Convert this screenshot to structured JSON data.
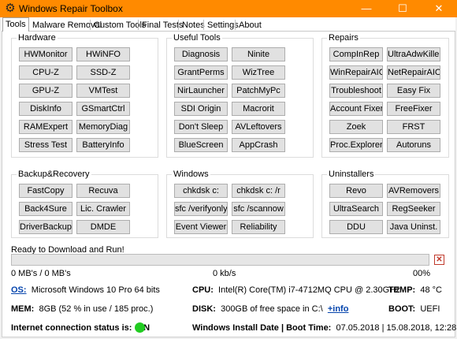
{
  "window": {
    "title": "Windows Repair Toolbox",
    "minimize": "—",
    "maximize": "☐",
    "close": "✕"
  },
  "tabs": [
    "Tools",
    "Malware Removal",
    "Custom Tools",
    "Final Tests",
    "Notes",
    "Settings",
    "About"
  ],
  "groups": {
    "hardware": {
      "label": "Hardware",
      "buttons": [
        "HWMonitor",
        "HWiNFO",
        "CPU-Z",
        "SSD-Z",
        "GPU-Z",
        "VMTest",
        "DiskInfo",
        "GSmartCtrl",
        "RAMExpert",
        "MemoryDiag",
        "Stress Test",
        "BatteryInfo"
      ]
    },
    "useful": {
      "label": "Useful Tools",
      "buttons": [
        "Diagnosis",
        "Ninite",
        "GrantPerms",
        "WizTree",
        "NirLauncher",
        "PatchMyPc",
        "SDI Origin",
        "Macrorit",
        "Don't Sleep",
        "AVLeftovers",
        "BlueScreen",
        "AppCrash"
      ]
    },
    "repairs": {
      "label": "Repairs",
      "buttons": [
        "CompInRep",
        "UltraAdwKiller",
        "WinRepairAIO",
        "NetRepairAIO",
        "Troubleshoot",
        "Easy Fix",
        "Account Fixer",
        "FreeFixer",
        "Zoek",
        "FRST",
        "Proc.Explorer",
        "Autoruns"
      ]
    },
    "backup": {
      "label": "Backup&Recovery",
      "buttons": [
        "FastCopy",
        "Recuva",
        "Back4Sure",
        "Lic. Crawler",
        "DriverBackup",
        "DMDE"
      ]
    },
    "windows": {
      "label": "Windows",
      "buttons": [
        "chkdsk c:",
        "chkdsk c: /r",
        "sfc /verifyonly",
        "sfc /scannow",
        "Event Viewer",
        "Reliability"
      ]
    },
    "uninstallers": {
      "label": "Uninstallers",
      "buttons": [
        "Revo",
        "AVRemovers",
        "UltraSearch",
        "RegSeeker",
        "DDU",
        "Java Uninst."
      ]
    }
  },
  "status": {
    "text": "Ready to Download and Run!",
    "mbs": "0 MB's / 0 MB's",
    "speed": "0 kb/s",
    "percent": "00%",
    "progress": 0,
    "cancel": "✕"
  },
  "system": {
    "os_label": "OS:",
    "os_value": "Microsoft Windows 10 Pro 64 bits",
    "cpu_label": "CPU:",
    "cpu_value": "Intel(R) Core(TM) i7-4712MQ CPU @ 2.30GHz",
    "temp_label": "TEMP:",
    "temp_value": "48 °C",
    "mem_label": "MEM:",
    "mem_value": "8GB  (52 % in use / 185 proc.)",
    "disk_label": "DISK:",
    "disk_value": "300GB of free space in C:\\",
    "disk_link": "+info",
    "boot_label": "BOOT:",
    "boot_value": "UEFI",
    "inet_label": "Internet connection status is:",
    "inet_value": "ON",
    "install_label": "Windows Install Date | Boot Time:",
    "install_value": "07.05.2018  |  15.08.2018, 12:28"
  },
  "colors": {
    "titlebar": "#ff8a00",
    "status_on": "#22cc22"
  }
}
